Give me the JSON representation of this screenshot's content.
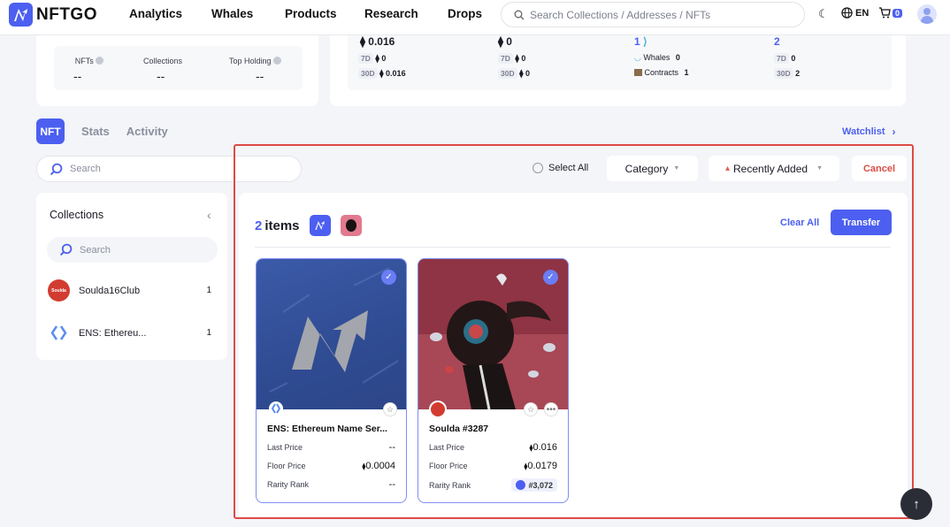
{
  "nav": {
    "brand": "NFTGO",
    "links": [
      "Analytics",
      "Whales",
      "Products",
      "Research",
      "Drops"
    ],
    "search_placeholder": "Search Collections / Addresses / NFTs",
    "lang": "EN",
    "cart_count": "0"
  },
  "profile_stats": {
    "nfts_label": "NFTs",
    "collections_label": "Collections",
    "top_holding_label": "Top Holding",
    "nfts_value": "--",
    "collections_value": "--",
    "top_holding_value": "--"
  },
  "summary": {
    "col1": {
      "main": "0.016",
      "d7_label": "7D",
      "d7_value": "0",
      "d30_label": "30D",
      "d30_value": "0.016"
    },
    "col2": {
      "main": "0",
      "d7_label": "7D",
      "d7_value": "0",
      "d30_label": "30D",
      "d30_value": "0"
    },
    "col3": {
      "main": "1",
      "whales_label": "Whales",
      "whales_value": "0",
      "contracts_label": "Contracts",
      "contracts_value": "1"
    },
    "col4": {
      "main": "2",
      "d7_label": "7D",
      "d7_value": "0",
      "d30_label": "30D",
      "d30_value": "2"
    }
  },
  "tabs": {
    "nft": "NFT",
    "stats": "Stats",
    "activity": "Activity"
  },
  "watchlist_label": "Watchlist",
  "toolbar": {
    "search_placeholder": "Search",
    "select_all": "Select All",
    "category": "Category",
    "sort": "Recently Added",
    "cancel": "Cancel"
  },
  "collections_panel": {
    "title": "Collections",
    "search_placeholder": "Search",
    "items": [
      {
        "name": "Soulda16Club",
        "count": "1",
        "logo_text": "Soulda"
      },
      {
        "name": "ENS: Ethereu...",
        "count": "1"
      }
    ]
  },
  "selection": {
    "count": "2",
    "items_label": "items",
    "clear_all": "Clear All",
    "transfer": "Transfer"
  },
  "nfts": [
    {
      "name": "ENS: Ethereum Name Ser...",
      "last_price_label": "Last Price",
      "last_price": "--",
      "floor_price_label": "Floor Price",
      "floor_price": "0.0004",
      "rarity_label": "Rarity Rank",
      "rarity": "--"
    },
    {
      "name": "Soulda #3287",
      "last_price_label": "Last Price",
      "last_price": "0.016",
      "floor_price_label": "Floor Price",
      "floor_price": "0.0179",
      "rarity_label": "Rarity Rank",
      "rarity": "#3,072"
    }
  ],
  "colors": {
    "accent": "#4c5ff0",
    "danger": "#dd4b46"
  }
}
